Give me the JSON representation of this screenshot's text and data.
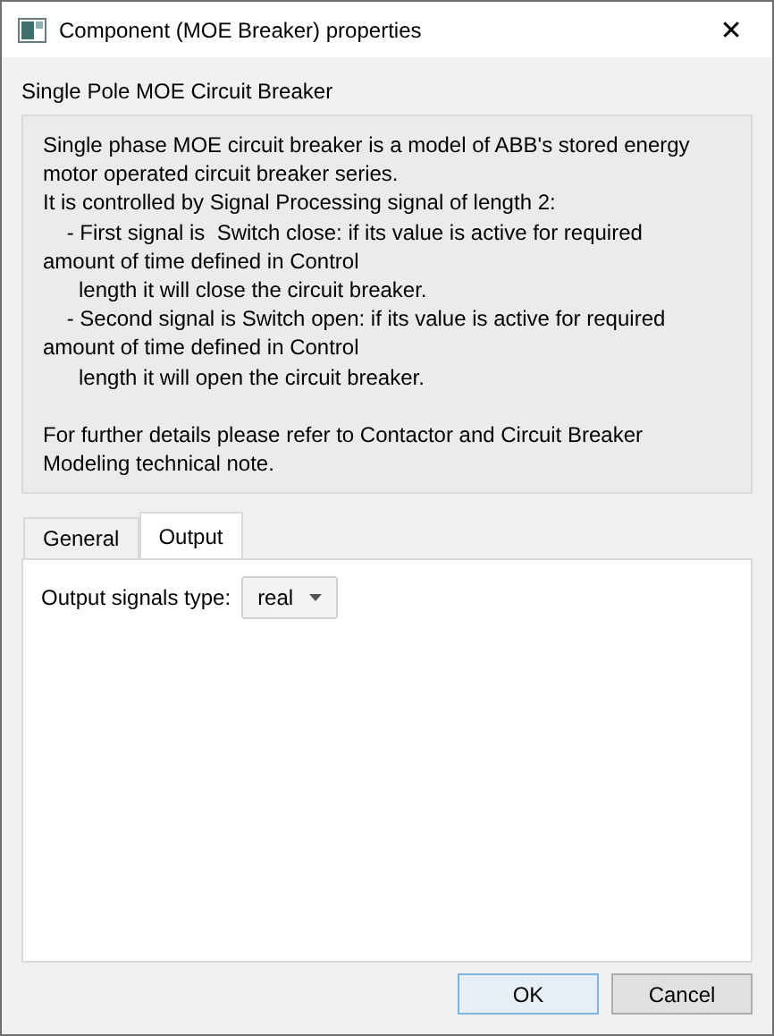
{
  "window": {
    "title": "Component (MOE Breaker) properties",
    "close": "✕"
  },
  "heading": "Single Pole MOE Circuit Breaker",
  "description": "Single phase MOE circuit breaker is a model of ABB's stored energy\nmotor operated circuit breaker series.\nIt is controlled by Signal Processing signal of length 2:\n    - First signal is  Switch close: if its value is active for required\namount of time defined in Control\n      length it will close the circuit breaker.\n    - Second signal is Switch open: if its value is active for required\namount of time defined in Control\n      length it will open the circuit breaker.\n\nFor further details please refer to Contactor and Circuit Breaker\nModeling technical note.",
  "tabs": [
    {
      "label": "General",
      "selected": false
    },
    {
      "label": "Output",
      "selected": true
    }
  ],
  "fields": [
    {
      "label": "Output signals type:",
      "value": "real"
    }
  ],
  "buttons": [
    {
      "label": "OK",
      "default": true
    },
    {
      "label": "Cancel",
      "default": false
    }
  ]
}
